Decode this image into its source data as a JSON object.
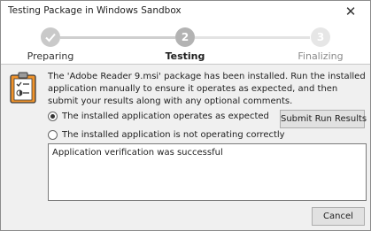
{
  "window": {
    "title": "Testing Package in Windows Sandbox",
    "close_glyph": "✕"
  },
  "wizard": {
    "steps": [
      {
        "label": "Preparing",
        "number": "",
        "state": "done",
        "icon": "checkmark-icon"
      },
      {
        "label": "Testing",
        "number": "2",
        "state": "active"
      },
      {
        "label": "Finalizing",
        "number": "3",
        "state": "pending"
      }
    ]
  },
  "message": "The 'Adobe Reader 9.msi' package has been installed. Run the installed application manually to ensure it operates as expected, and then submit your results along with any optional comments.",
  "options": [
    {
      "label": "The installed application operates as expected",
      "selected": true
    },
    {
      "label": "The installed application is not operating correctly",
      "selected": false
    }
  ],
  "submit_label": "Submit Run Results",
  "comments_value": "Application verification was successful",
  "cancel_label": "Cancel",
  "colors": {
    "step_done": "#c8c8c8",
    "step_active": "#b0b0b0",
    "step_pending": "#e6e6e6",
    "clipboard_orange": "#f0932b"
  }
}
